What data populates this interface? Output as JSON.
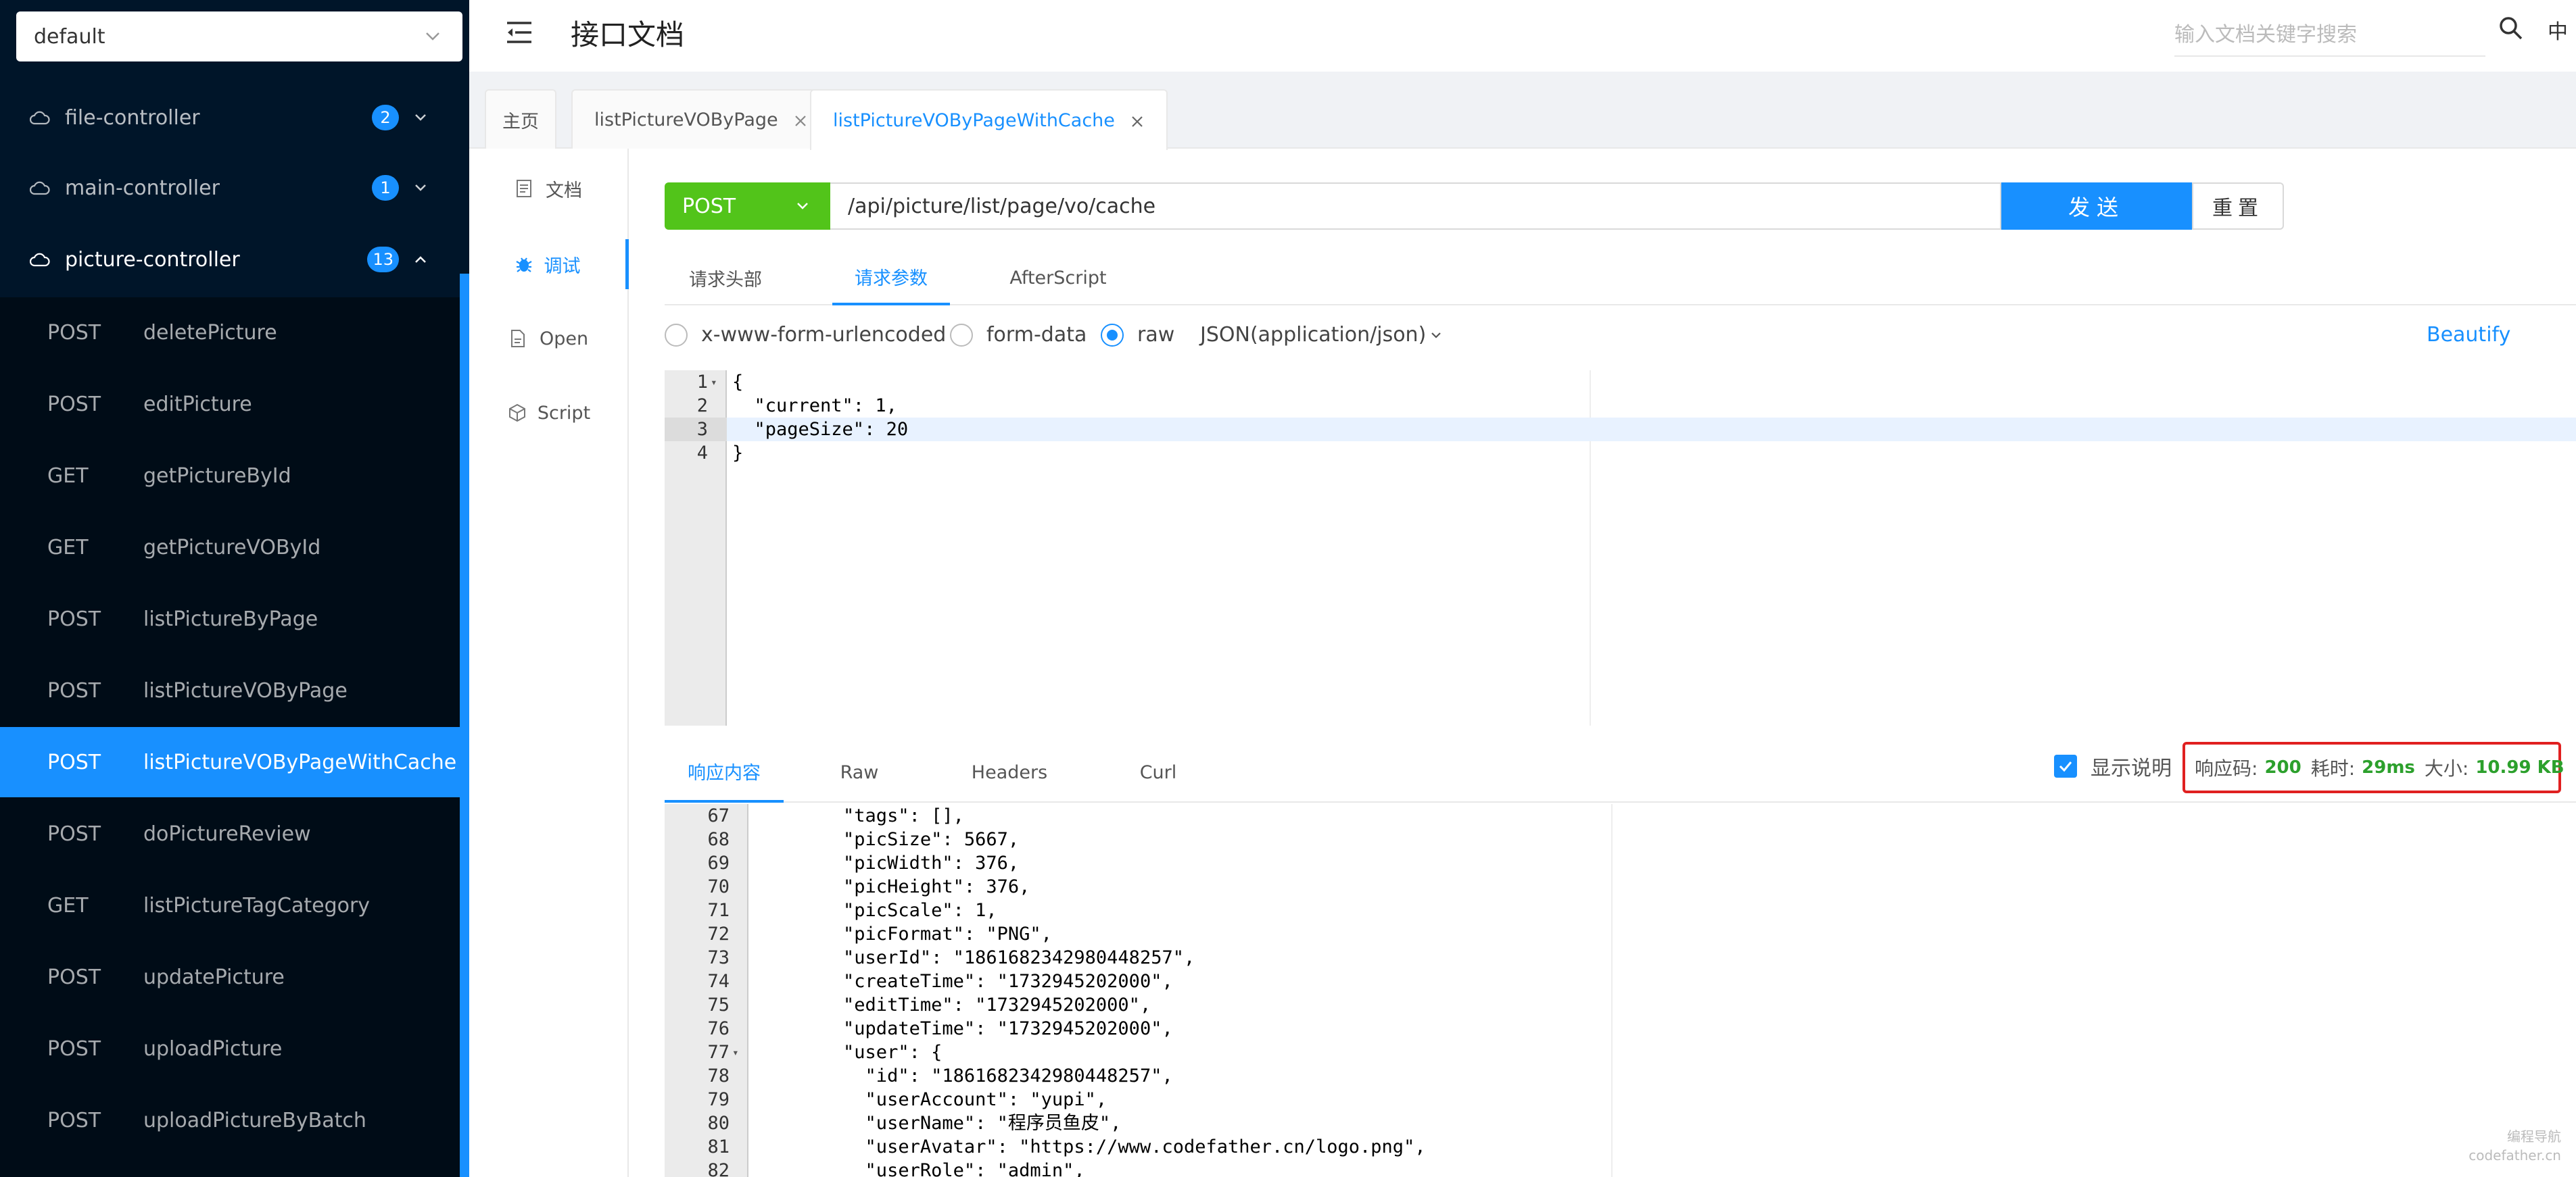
{
  "sidebar": {
    "group_select": "default",
    "controllers": [
      {
        "label": "file-controller",
        "count": "2"
      },
      {
        "label": "main-controller",
        "count": "1"
      },
      {
        "label": "picture-controller",
        "count": "13"
      }
    ],
    "apis": [
      {
        "method": "POST",
        "name": "deletePicture"
      },
      {
        "method": "POST",
        "name": "editPicture"
      },
      {
        "method": "GET",
        "name": "getPictureById"
      },
      {
        "method": "GET",
        "name": "getPictureVOById"
      },
      {
        "method": "POST",
        "name": "listPictureByPage"
      },
      {
        "method": "POST",
        "name": "listPictureVOByPage"
      },
      {
        "method": "POST",
        "name": "listPictureVOByPageWithCache"
      },
      {
        "method": "POST",
        "name": "doPictureReview"
      },
      {
        "method": "GET",
        "name": "listPictureTagCategory"
      },
      {
        "method": "POST",
        "name": "updatePicture"
      },
      {
        "method": "POST",
        "name": "uploadPicture"
      },
      {
        "method": "POST",
        "name": "uploadPictureByBatch"
      }
    ]
  },
  "header": {
    "title": "接口文档",
    "search_placeholder": "输入文档关键字搜索",
    "lang": "中"
  },
  "tabs": [
    "主页",
    "listPictureVOByPage",
    "listPictureVOByPageWithCache"
  ],
  "docmenu": [
    "文档",
    "调试",
    "Open",
    "Script"
  ],
  "request": {
    "method": "POST",
    "url": "/api/picture/list/page/vo/cache",
    "send": "发送",
    "reset": "重置",
    "subtabs": [
      "请求头部",
      "请求参数",
      "AfterScript"
    ],
    "body_types": [
      "x-www-form-urlencoded",
      "form-data",
      "raw"
    ],
    "content_type": "JSON(application/json)",
    "beautify": "Beautify",
    "lines": [
      {
        "n": "1",
        "text": "{"
      },
      {
        "n": "2",
        "text": "  \"current\": 1,"
      },
      {
        "n": "3",
        "text": "  \"pageSize\": 20"
      },
      {
        "n": "4",
        "text": "}"
      }
    ]
  },
  "response": {
    "tabs": [
      "响应内容",
      "Raw",
      "Headers",
      "Curl"
    ],
    "show_desc": "显示说明",
    "code_label": "响应码:",
    "code": "200",
    "time_label": "耗时:",
    "time": "29ms",
    "size_label": "大小:",
    "size": "10.99 KB",
    "lines": [
      {
        "n": "67",
        "text": "        \"tags\": [],"
      },
      {
        "n": "68",
        "text": "        \"picSize\": 5667,"
      },
      {
        "n": "69",
        "text": "        \"picWidth\": 376,"
      },
      {
        "n": "70",
        "text": "        \"picHeight\": 376,"
      },
      {
        "n": "71",
        "text": "        \"picScale\": 1,"
      },
      {
        "n": "72",
        "text": "        \"picFormat\": \"PNG\","
      },
      {
        "n": "73",
        "text": "        \"userId\": \"1861682342980448257\","
      },
      {
        "n": "74",
        "text": "        \"createTime\": \"1732945202000\","
      },
      {
        "n": "75",
        "text": "        \"editTime\": \"1732945202000\","
      },
      {
        "n": "76",
        "text": "        \"updateTime\": \"1732945202000\","
      },
      {
        "n": "77",
        "text": "        \"user\": {"
      },
      {
        "n": "78",
        "text": "          \"id\": \"1861682342980448257\","
      },
      {
        "n": "79",
        "text": "          \"userAccount\": \"yupi\","
      },
      {
        "n": "80",
        "text": "          \"userName\": \"程序员鱼皮\","
      },
      {
        "n": "81",
        "text": "          \"userAvatar\": \"https://www.codefather.cn/logo.png\","
      },
      {
        "n": "82",
        "text": "          \"userRole\": \"admin\","
      }
    ]
  },
  "watermark": [
    "编程导航",
    "codefather.cn"
  ],
  "colors": {
    "accent": "#1890ff",
    "post_green": "#52c41a",
    "sidebar_bg": "#001529",
    "status_box": "#e02020",
    "status_value": "#2ca02c"
  }
}
